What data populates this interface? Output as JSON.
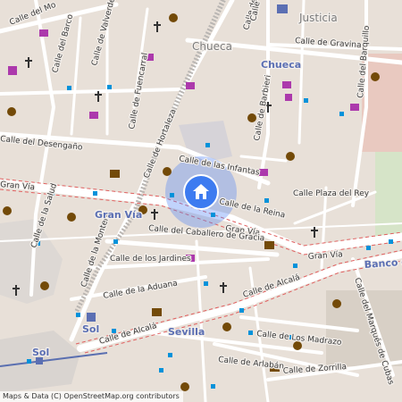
{
  "map": {
    "districts": [
      "Justicia",
      "Chueca",
      "Gran Vía",
      "Sol",
      "Sevilla"
    ],
    "metro_stations": [
      "Chueca",
      "Gran Vía",
      "Sol",
      "Sevilla"
    ],
    "streets": [
      "Calle de Gravina",
      "Calle de Pelayo",
      "Calle del Barquillo",
      "Calle del Barco",
      "Calle de Valverde",
      "Calle de Fuencarral",
      "Calle de Hortaleza",
      "Calle de Barbieri",
      "Calle de las Infantas",
      "Calle del Desengaño",
      "Calle Plaza del Rey",
      "Calle de la Reina",
      "Gran Vía",
      "Calle de la Salud",
      "Calle de la Montera",
      "Calle del Caballero de Gracia",
      "Calle de los Jardines",
      "Calle de la Aduana",
      "Calle de Alcalá",
      "Calle de Los Madrazo",
      "Calle del Marqués de Cubas",
      "Calle de Arlabán",
      "Calle de Zorrilla",
      "Calle de la Reina",
      "Calle de San Marcos",
      "Calle del Mo",
      "Calle del P"
    ],
    "bank_label": "Banco de España",
    "attribution": "Maps & Data (C) OpenStreetMap.org contributors"
  },
  "pin": {
    "icon": "home-icon"
  },
  "colors": {
    "land": "#e8e0d8",
    "road": "#ffffff",
    "pedestrian": "#dcd7d3",
    "pin": "#3d7bf0",
    "metro": "#5b6fb3",
    "poi_shop": "#ac39ac",
    "poi_theatre": "#734a08",
    "stop": "#0092da"
  }
}
